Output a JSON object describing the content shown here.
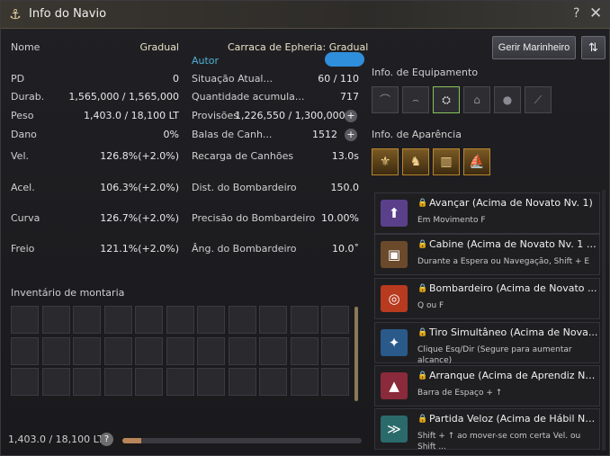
{
  "window": {
    "title": "Info do Navio"
  },
  "ship": {
    "name_label": "Nome",
    "name_value": "Gradual",
    "ship_title": "Carraca de Epheria: Gradual",
    "author": "Autor"
  },
  "left_stats": [
    {
      "label": "PD",
      "value": "0"
    },
    {
      "label": "Durab.",
      "value": "1,565,000 / 1,565,000"
    },
    {
      "label": "Peso",
      "value": "1,403.0 / 18,100 LT"
    },
    {
      "label": "Dano",
      "value": "0%"
    },
    {
      "label": "Vel.",
      "value": "126.8%(+2.0%)"
    },
    {
      "label": "Acel.",
      "value": "106.3%(+2.0%)"
    },
    {
      "label": "Curva",
      "value": "126.7%(+2.0%)"
    },
    {
      "label": "Freio",
      "value": "121.1%(+2.0%)"
    }
  ],
  "right_stats": [
    {
      "label": "Situação Atual...",
      "value": "60 / 110"
    },
    {
      "label": "Quantidade acumula...",
      "value": "717"
    },
    {
      "label": "Provisões",
      "value": "1,226,550 / 1,300,000"
    },
    {
      "label": "Balas de Canh...",
      "value": "1512"
    },
    {
      "label": "Recarga de Canhões",
      "value": "13.0s"
    },
    {
      "label": "Dist. do Bombardeiro",
      "value": "150.0"
    },
    {
      "label": "Precisão do Bombardeiro",
      "value": "10.00%"
    },
    {
      "label": "Âng. do Bombardeiro",
      "value": "10.0˚"
    }
  ],
  "buttons": {
    "manage_crew": "Gerir Marinheiro"
  },
  "equipment": {
    "title": "Info. de Equipamento"
  },
  "appearance": {
    "title": "Info. de Aparência"
  },
  "inventory": {
    "title": "Inventário de montaria",
    "weight": "1,403.0 / 18,100 LT",
    "fill_fraction": 0.078,
    "help": "?"
  },
  "skills": [
    {
      "name": "Avançar (Acima de Novato Nv. 1)",
      "desc": "Em Movimento F",
      "color": "#5a3f8a",
      "icon": "⬆"
    },
    {
      "name": "Cabine (Acima de Novato Nv. 1 e...",
      "desc": "Durante a Espera ou Navegação, Shift + E",
      "color": "#6a4a2a",
      "icon": "▣"
    },
    {
      "name": "Bombardeiro (Acima de Novato ...",
      "desc": "Q ou F",
      "color": "#b83a1f",
      "icon": "◎"
    },
    {
      "name": "Tiro Simultâneo (Acima de Nova...",
      "desc": "Clique Esq/Dir (Segure para aumentar alcance)",
      "color": "#2a5a8a",
      "icon": "✦"
    },
    {
      "name": "Arranque (Acima de Aprendiz Nv...",
      "desc": "Barra de Espaço + ↑",
      "color": "#8a2a3a",
      "icon": "▲"
    },
    {
      "name": "Partida Veloz (Acima de Hábil Nv...",
      "desc": "Shift + ↑ ao mover-se com certa Vel. ou Shift ...",
      "color": "#2a6a6a",
      "icon": "≫"
    }
  ]
}
